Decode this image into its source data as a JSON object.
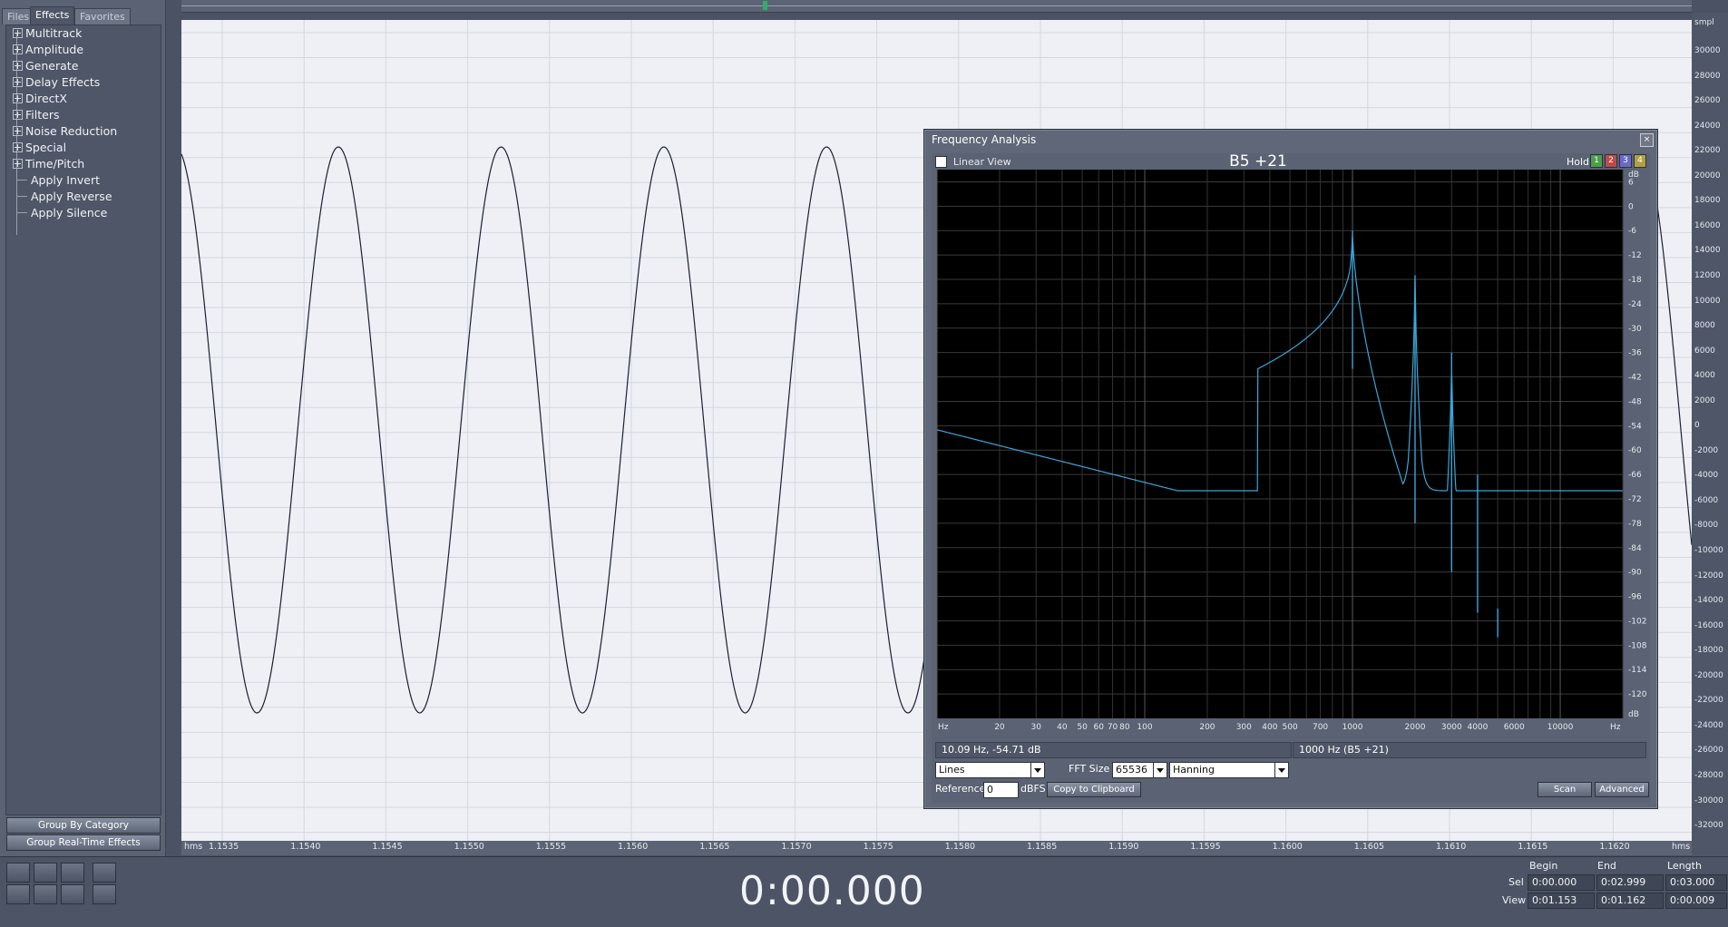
{
  "left_panel": {
    "tabs": [
      "Files",
      "Effects",
      "Favorites"
    ],
    "active_tab": "Effects",
    "groups": [
      "Multitrack",
      "Amplitude",
      "Generate",
      "Delay Effects",
      "DirectX",
      "Filters",
      "Noise Reduction",
      "Special",
      "Time/Pitch"
    ],
    "items": [
      "Apply Invert",
      "Apply Reverse",
      "Apply Silence"
    ],
    "group_by_category_button": "Group By Category",
    "group_realtime_button": "Group Real-Time Effects"
  },
  "waveform": {
    "timeline_unit_left": "hms",
    "timeline_unit_right": "hms",
    "timeline_labels": [
      "1.1535",
      "1.1540",
      "1.1545",
      "1.1550",
      "1.1555",
      "1.1560",
      "1.1565",
      "1.1570",
      "1.1575",
      "1.1580",
      "1.1585",
      "1.1590",
      "1.1595",
      "1.1600",
      "1.1605",
      "1.1610",
      "1.1615",
      "1.1620"
    ],
    "amplitude_unit": "smpl",
    "amplitude_labels": [
      "30000",
      "28000",
      "26000",
      "24000",
      "22000",
      "20000",
      "18000",
      "16000",
      "14000",
      "12000",
      "10000",
      "8000",
      "6000",
      "4000",
      "2000",
      "0",
      "-2000",
      "-4000",
      "-6000",
      "-8000",
      "-10000",
      "-12000",
      "-14000",
      "-16000",
      "-18000",
      "-20000",
      "-22000",
      "-24000",
      "-26000",
      "-28000",
      "-30000",
      "-32000"
    ],
    "wave_color": "#1a2030"
  },
  "frequency_analysis": {
    "title": "Frequency Analysis",
    "close": "×",
    "linear_view_label": "Linear View",
    "linear_view_checked": false,
    "note": "B5 +21",
    "hold_label": "Hold",
    "hold_buttons": [
      "1",
      "2",
      "3",
      "4"
    ],
    "hold_colors": [
      "#4aa04a",
      "#c04a4a",
      "#6a6ac8",
      "#b0a040"
    ],
    "spectrum_color": "#3aa6d8",
    "db_unit": "dB",
    "db_labels": [
      "6",
      "0",
      "-6",
      "-12",
      "-18",
      "-24",
      "-30",
      "-36",
      "-42",
      "-48",
      "-54",
      "-60",
      "-66",
      "-72",
      "-78",
      "-84",
      "-90",
      "-96",
      "-102",
      "-108",
      "-114",
      "-120"
    ],
    "hz_unit": "Hz",
    "hz_labels": [
      "20",
      "30",
      "40",
      "50",
      "60",
      "70",
      "80",
      "100",
      "200",
      "300",
      "400",
      "500",
      "700",
      "1000",
      "2000",
      "3000",
      "4000",
      "6000",
      "10000"
    ],
    "cursor_readout": "10.09 Hz, -54.71 dB",
    "peak_readout": "1000 Hz (B5 +21)",
    "plot_type": "Lines",
    "fft_size_label": "FFT Size",
    "fft_size": "65536",
    "window": "Hanning",
    "reference_label": "Reference",
    "reference_value": "0",
    "reference_unit": "dBFS",
    "copy_button": "Copy to Clipboard",
    "scan_button": "Scan",
    "advanced_button": "Advanced",
    "chart_data": {
      "type": "line",
      "xscale": "log",
      "xlim": [
        10,
        20000
      ],
      "ylim": [
        -126,
        9
      ],
      "peaks": [
        {
          "hz": 1000,
          "db": -6
        },
        {
          "hz": 2000,
          "db": -17
        },
        {
          "hz": 3000,
          "db": -36
        },
        {
          "hz": 4000,
          "db": -66
        },
        {
          "hz": 5000,
          "db": -99
        }
      ]
    }
  },
  "bottom": {
    "time": "0:00.000",
    "col_headers": [
      "Begin",
      "End",
      "Length"
    ],
    "sel_label": "Sel",
    "view_label": "View",
    "sel": [
      "0:00.000",
      "0:02.999",
      "0:03.000"
    ],
    "view": [
      "0:01.153",
      "0:01.162",
      "0:00.009"
    ]
  }
}
